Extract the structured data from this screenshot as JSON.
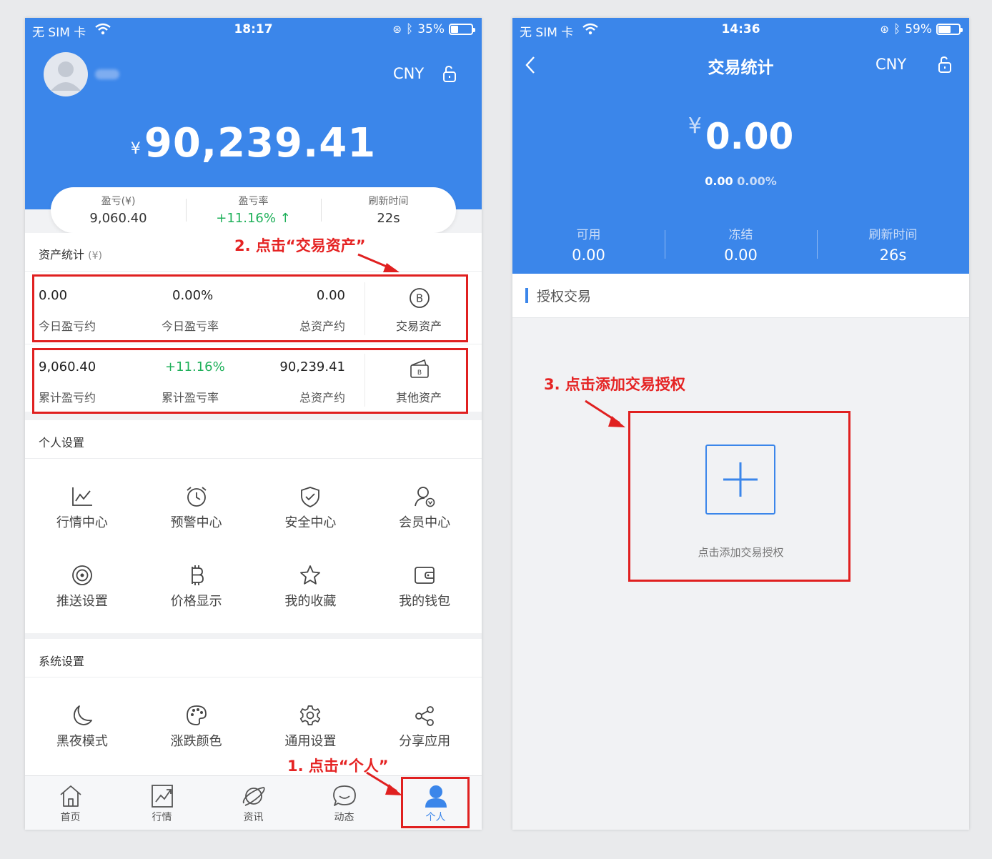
{
  "phone1": {
    "status": {
      "carrier": "无 SIM 卡",
      "time": "18:17",
      "battery": "35%",
      "battery_level": 0.35
    },
    "header": {
      "currency": "CNY",
      "currency_symbol": "¥",
      "total": "90,239.41"
    },
    "summary": [
      {
        "label": "盈亏(¥)",
        "value": "9,060.40"
      },
      {
        "label": "盈亏率",
        "value": "+11.16% ↑"
      },
      {
        "label": "刷新时间",
        "value": "22s"
      }
    ],
    "asset_stats": {
      "title": "资产统计",
      "unit": "(¥)",
      "row1": {
        "v1": "0.00",
        "l1": "今日盈亏约",
        "v2": "0.00%",
        "l2": "今日盈亏率",
        "v3": "0.00",
        "l3": "总资产约",
        "action": "交易资产"
      },
      "row2": {
        "v1": "9,060.40",
        "l1": "累计盈亏约",
        "v2": "+11.16%",
        "l2": "累计盈亏率",
        "v3": "90,239.41",
        "l3": "总资产约",
        "action": "其他资产"
      }
    },
    "personal_settings": {
      "title": "个人设置",
      "items": [
        "行情中心",
        "预警中心",
        "安全中心",
        "会员中心",
        "推送设置",
        "价格显示",
        "我的收藏",
        "我的钱包"
      ]
    },
    "system_settings": {
      "title": "系统设置",
      "items": [
        "黑夜模式",
        "涨跌颜色",
        "通用设置",
        "分享应用"
      ]
    },
    "tabbar": [
      "首页",
      "行情",
      "资讯",
      "动态",
      "个人"
    ],
    "annotations": {
      "step1": "1. 点击“个人”",
      "step2": "2. 点击“交易资产”"
    },
    "colors": {
      "accent": "#3b86ea",
      "up": "#1fb05a",
      "annotation": "#e02020"
    }
  },
  "phone2": {
    "status": {
      "carrier": "无 SIM 卡",
      "time": "14:36",
      "battery": "59%",
      "battery_level": 0.59
    },
    "nav": {
      "title": "交易统计",
      "currency": "CNY"
    },
    "amount": {
      "symbol": "¥",
      "value": "0.00",
      "sub_value": "0.00",
      "sub_rate": "0.00%"
    },
    "stats": [
      {
        "label": "可用",
        "value": "0.00"
      },
      {
        "label": "冻结",
        "value": "0.00"
      },
      {
        "label": "刷新时间",
        "value": "26s"
      }
    ],
    "section_title": "授权交易",
    "add_label": "点击添加交易授权",
    "annotations": {
      "step3": "3. 点击添加交易授权"
    }
  }
}
